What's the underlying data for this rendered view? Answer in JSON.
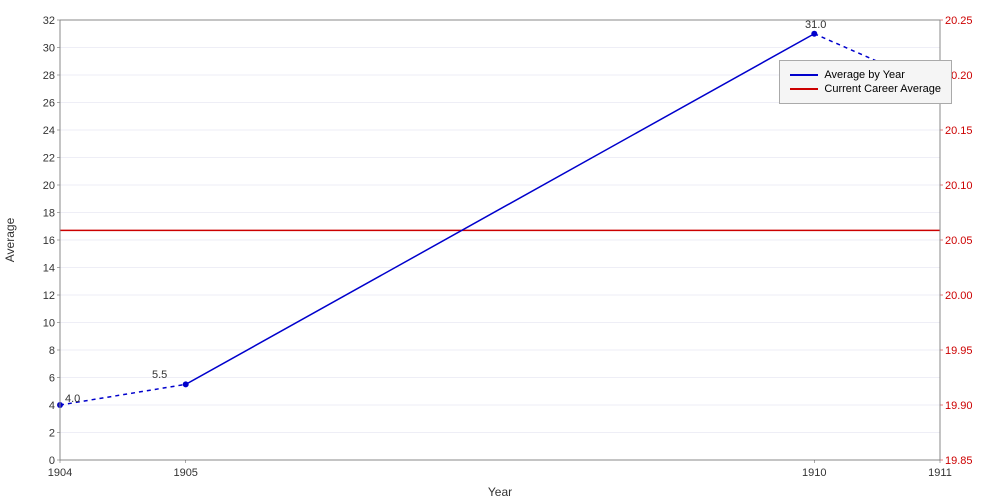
{
  "chart": {
    "title": "",
    "xAxis": {
      "label": "Year",
      "ticks": [
        "1904",
        "1905",
        "1910",
        "1911"
      ]
    },
    "yAxisLeft": {
      "label": "Average",
      "min": 0,
      "max": 32,
      "ticks": [
        0,
        2,
        4,
        6,
        8,
        10,
        12,
        14,
        16,
        18,
        20,
        22,
        24,
        26,
        28,
        30,
        32
      ]
    },
    "yAxisRight": {
      "min": 19.85,
      "max": 20.25,
      "ticks": [
        "20.25",
        "20.20",
        "20.15",
        "20.10",
        "20.05",
        "20.00",
        "19.95",
        "19.90",
        "19.85"
      ]
    },
    "dataPoints": [
      {
        "year": 1904,
        "value": 4.0,
        "label": "4.0"
      },
      {
        "year": 1905,
        "value": 5.5,
        "label": "5.5"
      },
      {
        "year": 1910,
        "value": 31.0,
        "label": "31.0"
      },
      {
        "year": 1911,
        "value": 27.0,
        "label": ""
      }
    ],
    "careerAverage": 16.7,
    "annotations": {
      "point1904": "4.0",
      "point1905": "5.5",
      "point1910": "31.0",
      "point1911": "27"
    }
  },
  "legend": {
    "items": [
      {
        "label": "Average by Year",
        "color": "#0000cc",
        "type": "line"
      },
      {
        "label": "Current Career Average",
        "color": "#cc0000",
        "type": "line"
      }
    ]
  }
}
